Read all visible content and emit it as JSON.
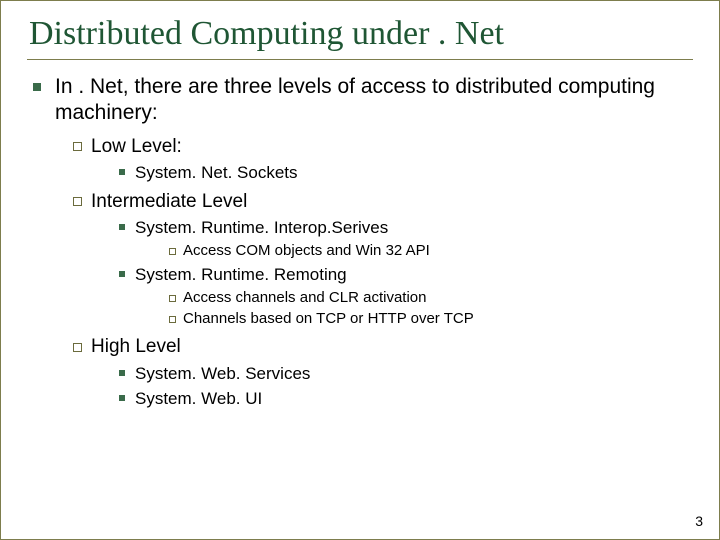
{
  "title": "Distributed Computing under . Net",
  "intro": "In . Net, there are three levels of access to distributed computing machinery:",
  "levels": {
    "low": {
      "label": "Low Level:",
      "items": {
        "sockets": "System. Net. Sockets"
      }
    },
    "intermediate": {
      "label": "Intermediate Level",
      "interop": {
        "label": "System. Runtime. Interop.Serives",
        "notes": {
          "com": "Access COM objects and Win 32 API"
        }
      },
      "remoting": {
        "label": "System. Runtime. Remoting",
        "notes": {
          "activation": "Access channels and CLR activation",
          "protocol": "Channels based on TCP or HTTP over TCP"
        }
      }
    },
    "high": {
      "label": "High Level",
      "items": {
        "webservices": "System. Web. Services",
        "webui": "System. Web. UI"
      }
    }
  },
  "page_number": "3"
}
